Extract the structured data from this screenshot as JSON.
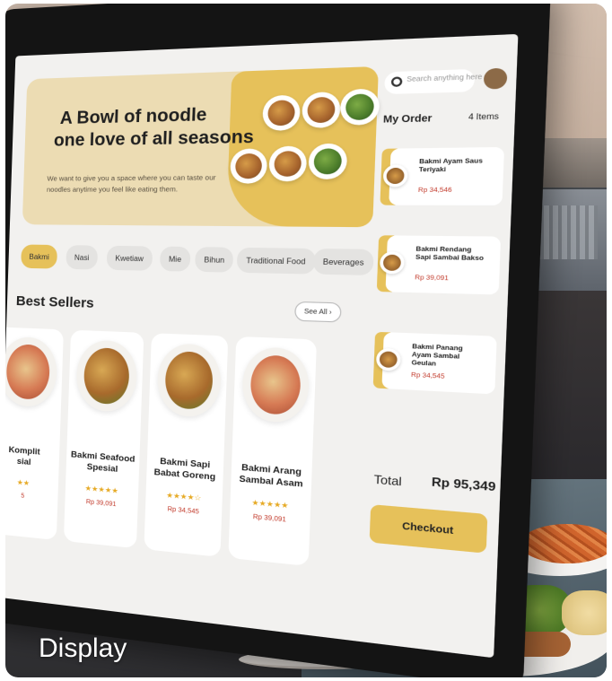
{
  "caption": "Display",
  "banner": {
    "title_line1": "A Bowl of noodle",
    "title_line2": "one love of all seasons",
    "subtitle": "We want to give you a space where you can taste our noodles anytime you feel like eating them."
  },
  "search": {
    "placeholder": "Search anything here"
  },
  "order": {
    "heading": "My Order",
    "count": "4 Items",
    "items": [
      {
        "name": "Bakmi Ayam Saus Teriyaki",
        "price": "Rp 34,546"
      },
      {
        "name": "Bakmi Rendang Sapi Sambal Bakso",
        "price": "Rp 39,091"
      },
      {
        "name": "Bakmi Panang Ayam Sambal Geulan",
        "price": "Rp 34,545"
      }
    ],
    "total_label": "Total",
    "total_value": "Rp 95,349",
    "checkout_label": "Checkout"
  },
  "categories": [
    "Bakmi",
    "Nasi",
    "Kwetiaw",
    "Mie",
    "Bihun",
    "Traditional Food",
    "Beverages"
  ],
  "best_sellers": {
    "heading": "Best Sellers",
    "see_all": "See All",
    "products": [
      {
        "name_line1": "Komplit",
        "name_line2": "sial",
        "stars": "★★",
        "price": "5"
      },
      {
        "name_line1": "Bakmi Seafood",
        "name_line2": "Spesial",
        "stars": "★★★★★",
        "price": "Rp 39,091"
      },
      {
        "name_line1": "Bakmi Sapi",
        "name_line2": "Babat Goreng",
        "stars": "★★★★☆",
        "price": "Rp 34,545"
      },
      {
        "name_line1": "Bakmi Arang",
        "name_line2": "Sambal Asam",
        "stars": "★★★★★",
        "price": "Rp 39,091"
      }
    ]
  },
  "colors": {
    "accent": "#e6c15a",
    "price": "#c23a2b"
  }
}
